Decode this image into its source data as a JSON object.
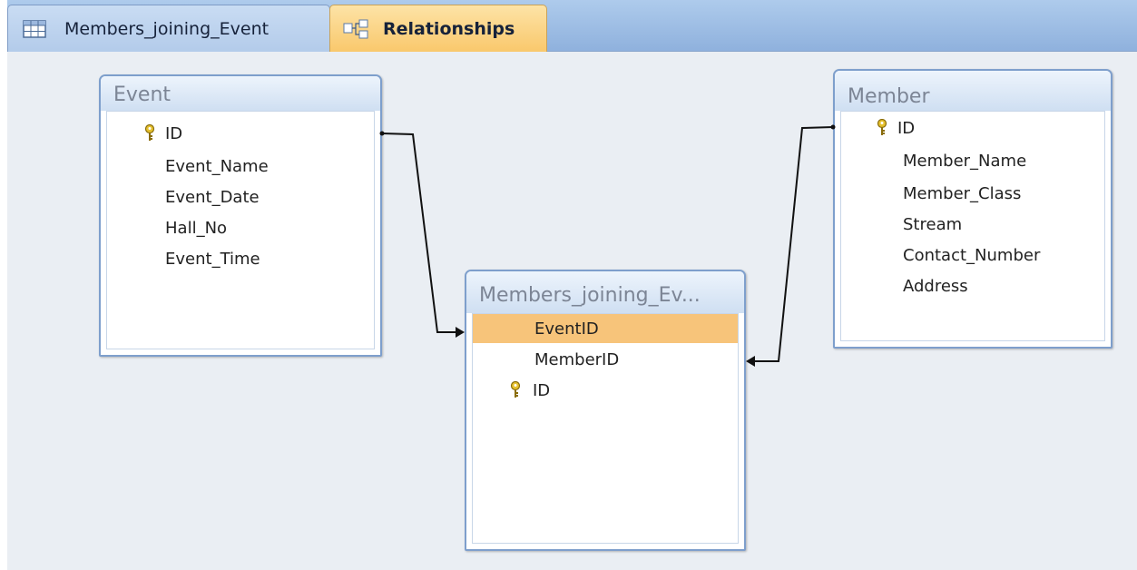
{
  "tabs": [
    {
      "label": "Members_joining_Event",
      "icon": "table-icon",
      "active": false
    },
    {
      "label": "Relationships",
      "icon": "relationships-icon",
      "active": true
    }
  ],
  "tables": {
    "event": {
      "title": "Event",
      "fields": [
        {
          "name": "ID",
          "primary_key": true
        },
        {
          "name": "Event_Name"
        },
        {
          "name": "Event_Date"
        },
        {
          "name": "Hall_No"
        },
        {
          "name": "Event_Time"
        }
      ]
    },
    "members_joining_event": {
      "title": "Members_joining_Ev...",
      "fields": [
        {
          "name": "EventID",
          "selected": true
        },
        {
          "name": "MemberID"
        },
        {
          "name": "ID",
          "primary_key": true
        }
      ]
    },
    "member": {
      "title": "Member",
      "fields": [
        {
          "name": "ID",
          "primary_key": true
        },
        {
          "name": "Member_Name"
        },
        {
          "name": "Member_Class"
        },
        {
          "name": "Stream"
        },
        {
          "name": "Contact_Number"
        },
        {
          "name": "Address"
        }
      ]
    }
  },
  "relationships": [
    {
      "from": "Event.ID",
      "to": "Members_joining_Event.EventID"
    },
    {
      "from": "Member.ID",
      "to": "Members_joining_Event.MemberID"
    }
  ],
  "colors": {
    "tab_strip": "#9dbde4",
    "active_tab": "#f9c86c",
    "canvas": "#eaeef3",
    "table_border": "#7e9fcc",
    "selected_field": "#f7c47a",
    "key_icon": "#c9a21a"
  }
}
